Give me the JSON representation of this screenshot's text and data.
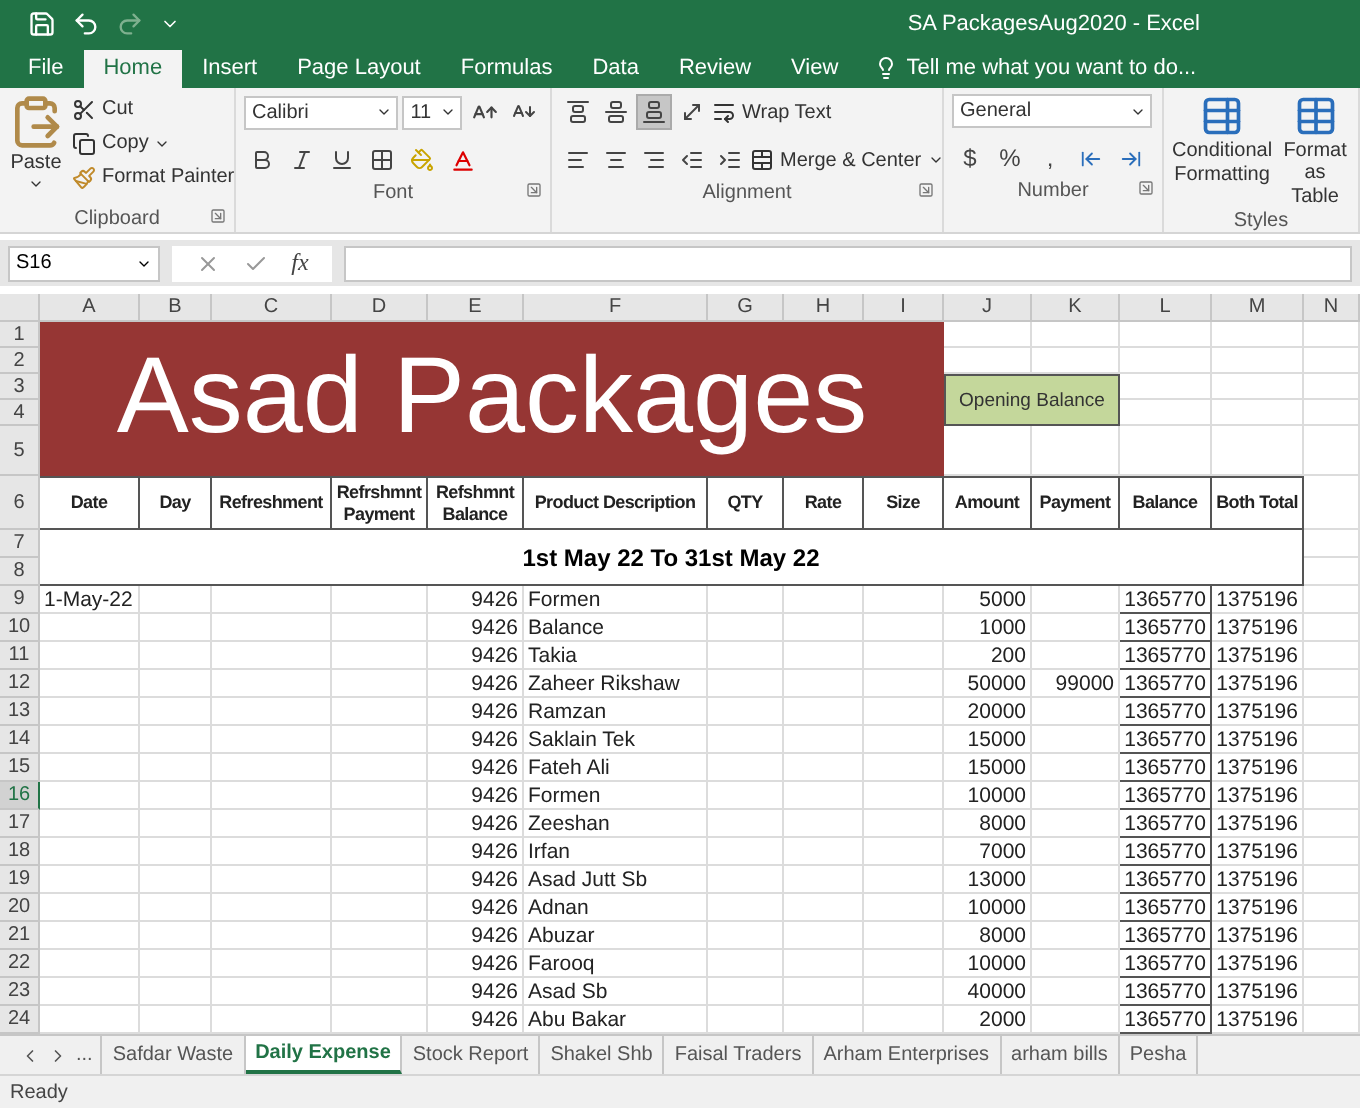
{
  "window": {
    "title": "SA PackagesAug2020 - Excel"
  },
  "ribbon_tabs": [
    {
      "label": "File",
      "selected": false
    },
    {
      "label": "Home",
      "selected": true
    },
    {
      "label": "Insert",
      "selected": false
    },
    {
      "label": "Page Layout",
      "selected": false
    },
    {
      "label": "Formulas",
      "selected": false
    },
    {
      "label": "Data",
      "selected": false
    },
    {
      "label": "Review",
      "selected": false
    },
    {
      "label": "View",
      "selected": false
    }
  ],
  "tell_me": {
    "placeholder": "Tell me what you want to do..."
  },
  "ribbon": {
    "clipboard": {
      "label": "Clipboard",
      "paste": "Paste",
      "cut": "Cut",
      "copy": "Copy",
      "format_painter": "Format Painter"
    },
    "font": {
      "label": "Font",
      "font_name": "Calibri",
      "font_size": "11"
    },
    "alignment": {
      "label": "Alignment",
      "vertical_alignment": [
        {
          "selected": false
        },
        {
          "selected": false
        },
        {
          "selected": true
        }
      ],
      "wrap_text": "Wrap Text",
      "merge_center": "Merge & Center"
    },
    "number": {
      "label": "Number",
      "format": "General",
      "currency": "$",
      "percent": "%",
      "comma": ","
    },
    "styles": {
      "label": "Styles",
      "conditional_formatting": [
        "Conditional",
        "Formatting"
      ],
      "format_as_table": [
        "Format as",
        "Table"
      ]
    }
  },
  "formula_bar": {
    "name_box": "S16",
    "function_label": "fx"
  },
  "sheet": {
    "columns": [
      "A",
      "B",
      "C",
      "D",
      "E",
      "F",
      "G",
      "H",
      "I",
      "J",
      "K",
      "L",
      "M",
      "N"
    ],
    "row_numbers": [
      {
        "label": "1",
        "selected": false
      },
      {
        "label": "2",
        "selected": false
      },
      {
        "label": "3",
        "selected": false
      },
      {
        "label": "4",
        "selected": false
      },
      {
        "label": "5",
        "selected": false
      },
      {
        "label": "6",
        "selected": false
      },
      {
        "label": "7",
        "selected": false
      },
      {
        "label": "8",
        "selected": false
      },
      {
        "label": "9",
        "selected": false
      },
      {
        "label": "10",
        "selected": false
      },
      {
        "label": "11",
        "selected": false
      },
      {
        "label": "12",
        "selected": false
      },
      {
        "label": "13",
        "selected": false
      },
      {
        "label": "14",
        "selected": false
      },
      {
        "label": "15",
        "selected": false
      },
      {
        "label": "16",
        "selected": true
      },
      {
        "label": "17",
        "selected": false
      },
      {
        "label": "18",
        "selected": false
      },
      {
        "label": "19",
        "selected": false
      },
      {
        "label": "20",
        "selected": false
      },
      {
        "label": "21",
        "selected": false
      },
      {
        "label": "22",
        "selected": false
      },
      {
        "label": "23",
        "selected": false
      },
      {
        "label": "24",
        "selected": false
      }
    ],
    "banner": "Asad Packages",
    "opening_balance": "Opening Balance",
    "headers": [
      "Date",
      "Day",
      "Refreshment",
      "Refrshmnt Payment",
      "Refshmnt Balance",
      "Product Description",
      "QTY",
      "Rate",
      "Size",
      "Amount",
      "Payment",
      "Balance",
      "Both Total"
    ],
    "period": "1st May 22 To 31st May 22",
    "rows": [
      {
        "date": "1-May-22",
        "refreshment_balance": "9426",
        "product": "Formen",
        "amount": "5000",
        "balance": "1365770",
        "both_total": "1375196"
      },
      {
        "refreshment_balance": "9426",
        "product": "Balance",
        "amount": "1000",
        "balance": "1365770",
        "both_total": "1375196"
      },
      {
        "refreshment_balance": "9426",
        "product": "Takia",
        "amount": "200",
        "balance": "1365770",
        "both_total": "1375196"
      },
      {
        "refreshment_balance": "9426",
        "product": "Zaheer Rikshaw",
        "amount": "50000",
        "payment": "99000",
        "balance": "1365770",
        "both_total": "1375196"
      },
      {
        "refreshment_balance": "9426",
        "product": "Ramzan",
        "amount": "20000",
        "balance": "1365770",
        "both_total": "1375196"
      },
      {
        "refreshment_balance": "9426",
        "product": "Saklain Tek",
        "amount": "15000",
        "balance": "1365770",
        "both_total": "1375196"
      },
      {
        "refreshment_balance": "9426",
        "product": "Fateh Ali",
        "amount": "15000",
        "balance": "1365770",
        "both_total": "1375196"
      },
      {
        "refreshment_balance": "9426",
        "product": "Formen",
        "amount": "10000",
        "balance": "1365770",
        "both_total": "1375196"
      },
      {
        "refreshment_balance": "9426",
        "product": "Zeeshan",
        "amount": "8000",
        "balance": "1365770",
        "both_total": "1375196"
      },
      {
        "refreshment_balance": "9426",
        "product": "Irfan",
        "amount": "7000",
        "balance": "1365770",
        "both_total": "1375196"
      },
      {
        "refreshment_balance": "9426",
        "product": "Asad Jutt Sb",
        "amount": "13000",
        "balance": "1365770",
        "both_total": "1375196"
      },
      {
        "refreshment_balance": "9426",
        "product": "Adnan",
        "amount": "10000",
        "balance": "1365770",
        "both_total": "1375196"
      },
      {
        "refreshment_balance": "9426",
        "product": "Abuzar",
        "amount": "8000",
        "balance": "1365770",
        "both_total": "1375196"
      },
      {
        "refreshment_balance": "9426",
        "product": "Farooq",
        "amount": "10000",
        "balance": "1365770",
        "both_total": "1375196"
      },
      {
        "refreshment_balance": "9426",
        "product": "Asad Sb",
        "amount": "40000",
        "balance": "1365770",
        "both_total": "1375196"
      },
      {
        "refreshment_balance": "9426",
        "product": "Abu Bakar",
        "amount": "2000",
        "balance": "1365770",
        "both_total": "1375196"
      }
    ]
  },
  "sheet_tabs": {
    "more": "...",
    "tabs": [
      {
        "label": "Safdar Waste",
        "selected": false
      },
      {
        "label": "Daily Expense",
        "selected": true
      },
      {
        "label": "Stock Report",
        "selected": false
      },
      {
        "label": "Shakel Shb",
        "selected": false
      },
      {
        "label": "Faisal Traders",
        "selected": false
      },
      {
        "label": "Arham Enterprises",
        "selected": false
      },
      {
        "label": "arham bills",
        "selected": false
      },
      {
        "label": "Pesha",
        "selected": false
      }
    ]
  },
  "status_bar": {
    "text": "Ready"
  }
}
